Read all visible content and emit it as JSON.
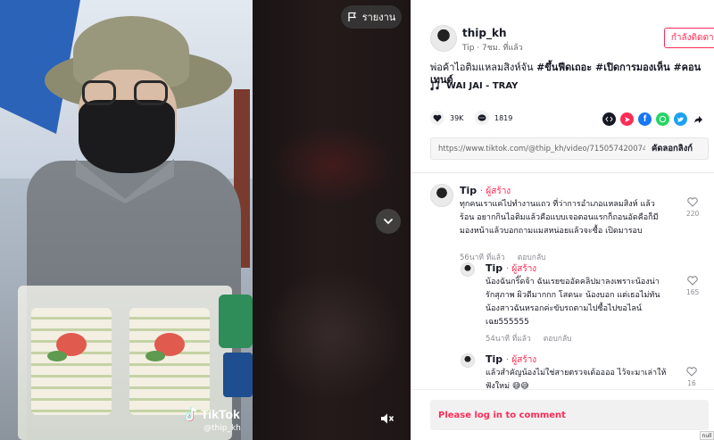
{
  "video": {
    "report_label": "รายงาน",
    "watermark_brand": "TikTok",
    "watermark_handle": "@thip_kh"
  },
  "author": {
    "name": "thip_kh",
    "sub": "Tip · 7ชม. ที่แล้ว",
    "follow_label": "กำลังติดตาม"
  },
  "caption": {
    "text": "พ่อค้าไอติมแหลมสิงห์จัน ",
    "tags": "#ขึ้นฟีดเถอะ #เปิดการมองเห็น #คอนเทนต์"
  },
  "music": {
    "title": "WAI JAI - TRAY"
  },
  "actions": {
    "likes": "39K",
    "comments": "1819"
  },
  "share": {
    "link": "https://www.tiktok.com/@thip_kh/video/7150574200749...",
    "copy_label": "คัดลอกลิงก์"
  },
  "comments": [
    {
      "name": "Tip",
      "badge": "· ผู้สร้าง",
      "line1": "ทุกคนเราแค่ไปทำงานแถว ที่ว่าการอำเภอแหลมสิงห์ แล้ว",
      "line2": "ร้อน อยากกินไอติมแล้วคือแบบเจอตอนแรกก็ถอนอัดคือก็มี",
      "line3": "มองหน้าแล้วบอกถามแมสหน่อยแล้วจะซื้อ เปิดมารอบ",
      "time": "56นาที ที่แล้ว",
      "reply": "ตอบกลับ",
      "likes": "220"
    },
    {
      "name": "Tip",
      "badge": "· ผู้สร้าง",
      "line1": "น้องฉันกริ๊ดจ้า ฉันเรยขออัดคลิปมาลงเพราะน้องน่า",
      "line2": "รักสุภาพ ผิวดีมากกก โสดนะ น้องบอก แต่เธอไม่ทัน",
      "line3": "น้องสาวฉันหรอกค่ะขับรถตามไปซื้อไปขอไลน์",
      "line4": "เฉย555555",
      "time": "54นาที ที่แล้ว",
      "reply": "ตอบกลับ",
      "likes": "165"
    },
    {
      "name": "Tip",
      "badge": "· ผู้สร้าง",
      "line1": "แล้วสำคัญน้องไม่ใช่สายตรวจเด้ออออ ไว้จะมาเล่าให้",
      "line2": "ฟังใหม่ 😅😅",
      "likes": "16"
    }
  ],
  "login": {
    "label": "Please log in to comment"
  },
  "corner_tag": "null",
  "colors": {
    "accent": "#fe2c55",
    "text": "#161823",
    "muted": "#8a8b91"
  }
}
